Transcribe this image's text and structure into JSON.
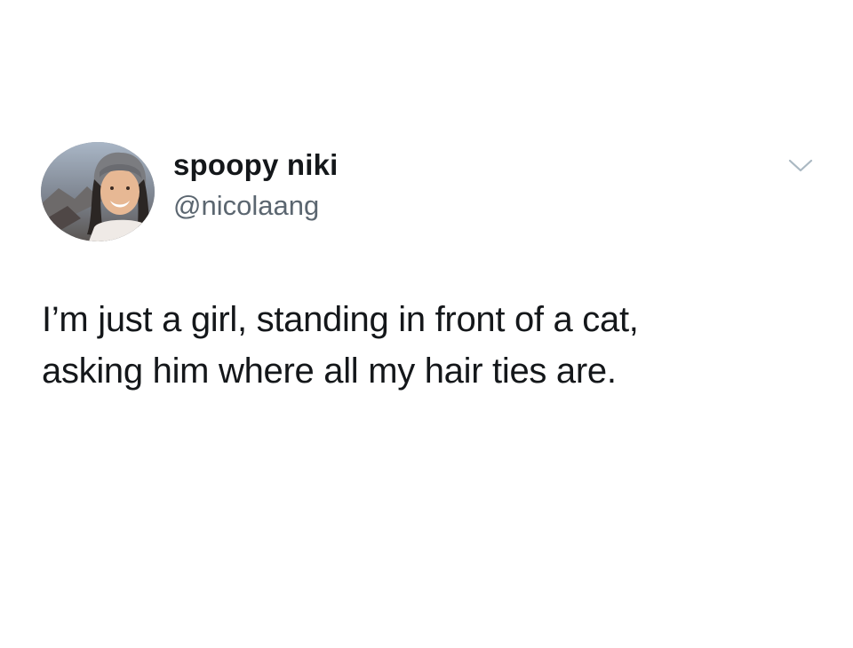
{
  "user": {
    "display_name": "spoopy niki",
    "handle": "@nicolaang",
    "avatar_icon": "profile-photo"
  },
  "tweet": {
    "lines": [
      "I’m just a girl, standing in front of a cat,",
      "asking him where all my hair ties are."
    ]
  },
  "menu": {
    "icon": "chevron-down-icon"
  },
  "colors": {
    "background": "#ffffff",
    "text": "#14171a",
    "secondary_text": "#5b6670",
    "chevron": "#aab8c2"
  }
}
